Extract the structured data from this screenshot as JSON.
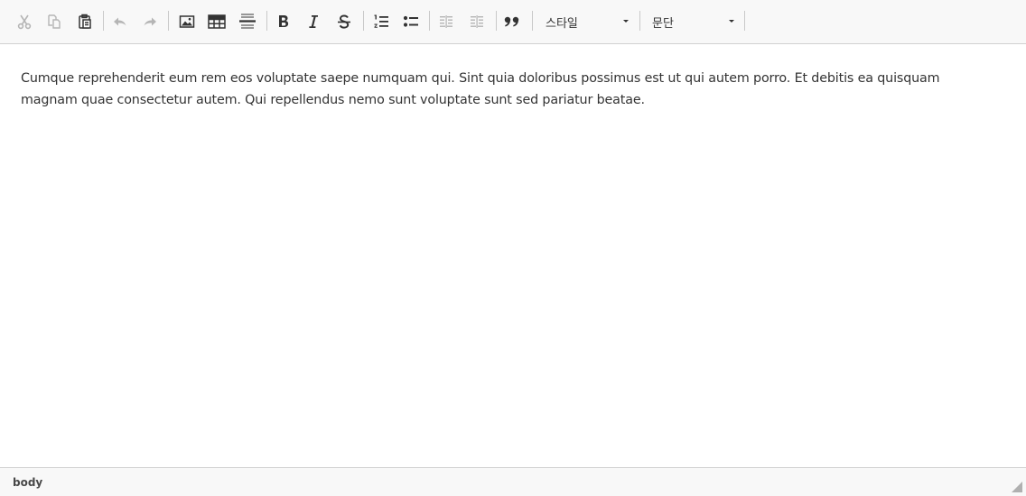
{
  "toolbar": {
    "buttons": [
      {
        "icon": "cut-icon",
        "state": "disabled"
      },
      {
        "icon": "copy-icon",
        "state": "disabled"
      },
      {
        "icon": "paste-icon",
        "state": "enabled"
      },
      {
        "icon": "undo-icon",
        "state": "disabled"
      },
      {
        "icon": "redo-icon",
        "state": "disabled"
      },
      {
        "icon": "image-icon",
        "state": "enabled"
      },
      {
        "icon": "table-icon",
        "state": "enabled"
      },
      {
        "icon": "horizontal-line-icon",
        "state": "enabled"
      },
      {
        "icon": "bold-icon",
        "state": "enabled"
      },
      {
        "icon": "italic-icon",
        "state": "enabled"
      },
      {
        "icon": "strikethrough-icon",
        "state": "enabled"
      },
      {
        "icon": "numbered-list-icon",
        "state": "enabled"
      },
      {
        "icon": "bulleted-list-icon",
        "state": "enabled"
      },
      {
        "icon": "decrease-indent-icon",
        "state": "disabled"
      },
      {
        "icon": "increase-indent-icon",
        "state": "disabled"
      },
      {
        "icon": "blockquote-icon",
        "state": "enabled"
      }
    ],
    "style_combo": {
      "label": "스타일"
    },
    "format_combo": {
      "label": "문단"
    }
  },
  "content": {
    "paragraph": "Cumque reprehenderit eum rem eos voluptate saepe numquam qui. Sint quia doloribus possimus est ut qui autem porro. Et debitis ea quisquam magnam quae consectetur autem. Qui repellendus nemo sunt voluptate sunt sed pariatur beatae."
  },
  "statusbar": {
    "element_path": "body"
  },
  "colors": {
    "icon_enabled": "#333333",
    "icon_disabled": "#b5b5b5",
    "toolbar_bg": "#f8f8f8",
    "border": "#d1d1d1"
  }
}
